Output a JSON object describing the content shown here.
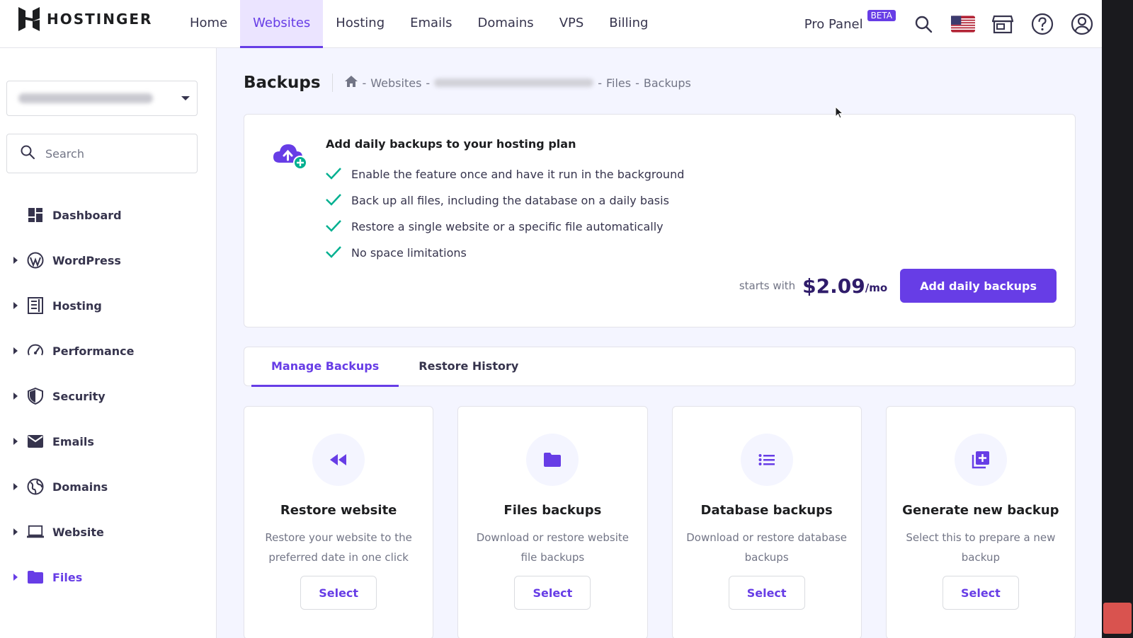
{
  "brand": {
    "name": "HOSTINGER"
  },
  "nav": {
    "items": [
      {
        "label": "Home",
        "active": false
      },
      {
        "label": "Websites",
        "active": true
      },
      {
        "label": "Hosting",
        "active": false
      },
      {
        "label": "Emails",
        "active": false
      },
      {
        "label": "Domains",
        "active": false
      },
      {
        "label": "VPS",
        "active": false
      },
      {
        "label": "Billing",
        "active": false
      }
    ],
    "pro_panel": "Pro Panel",
    "beta_badge": "BETA",
    "icons": [
      "search-icon",
      "us-flag-icon",
      "store-icon",
      "help-icon",
      "account-icon"
    ]
  },
  "sidebar": {
    "search_placeholder": "Search",
    "items": [
      {
        "label": "Dashboard",
        "icon": "dashboard-icon",
        "expandable": false
      },
      {
        "label": "WordPress",
        "icon": "wordpress-icon",
        "expandable": true
      },
      {
        "label": "Hosting",
        "icon": "hosting-icon",
        "expandable": true
      },
      {
        "label": "Performance",
        "icon": "speedometer-icon",
        "expandable": true
      },
      {
        "label": "Security",
        "icon": "shield-icon",
        "expandable": true
      },
      {
        "label": "Emails",
        "icon": "envelope-icon",
        "expandable": true
      },
      {
        "label": "Domains",
        "icon": "globe-icon",
        "expandable": true
      },
      {
        "label": "Website",
        "icon": "laptop-icon",
        "expandable": true
      },
      {
        "label": "Files",
        "icon": "folder-icon",
        "expandable": true,
        "active": true
      }
    ]
  },
  "page": {
    "title": "Backups",
    "breadcrumb": {
      "websites": "Websites",
      "files": "Files",
      "backups": "Backups",
      "separator": "-"
    }
  },
  "promo": {
    "title": "Add daily backups to your hosting plan",
    "features": [
      "Enable the feature once and have it run in the background",
      "Back up all files, including the database on a daily basis",
      "Restore a single website or a specific file automatically",
      "No space limitations"
    ],
    "starts_with": "starts with",
    "price": "$2.09",
    "per": "/mo",
    "cta": "Add daily backups"
  },
  "tabs": [
    {
      "label": "Manage Backups",
      "active": true
    },
    {
      "label": "Restore History",
      "active": false
    }
  ],
  "cards": [
    {
      "title": "Restore website",
      "desc": "Restore your website to the preferred date in one click",
      "button": "Select",
      "icon": "rewind-icon"
    },
    {
      "title": "Files backups",
      "desc": "Download or restore website file backups",
      "button": "Select",
      "icon": "folder-icon"
    },
    {
      "title": "Database backups",
      "desc": "Download or restore database backups",
      "button": "Select",
      "icon": "list-icon"
    },
    {
      "title": "Generate new backup",
      "desc": "Select this to prepare a new backup",
      "button": "Select",
      "icon": "add-copy-icon"
    }
  ],
  "colors": {
    "accent": "#673de6",
    "success": "#00b090",
    "text": "#36344d"
  }
}
